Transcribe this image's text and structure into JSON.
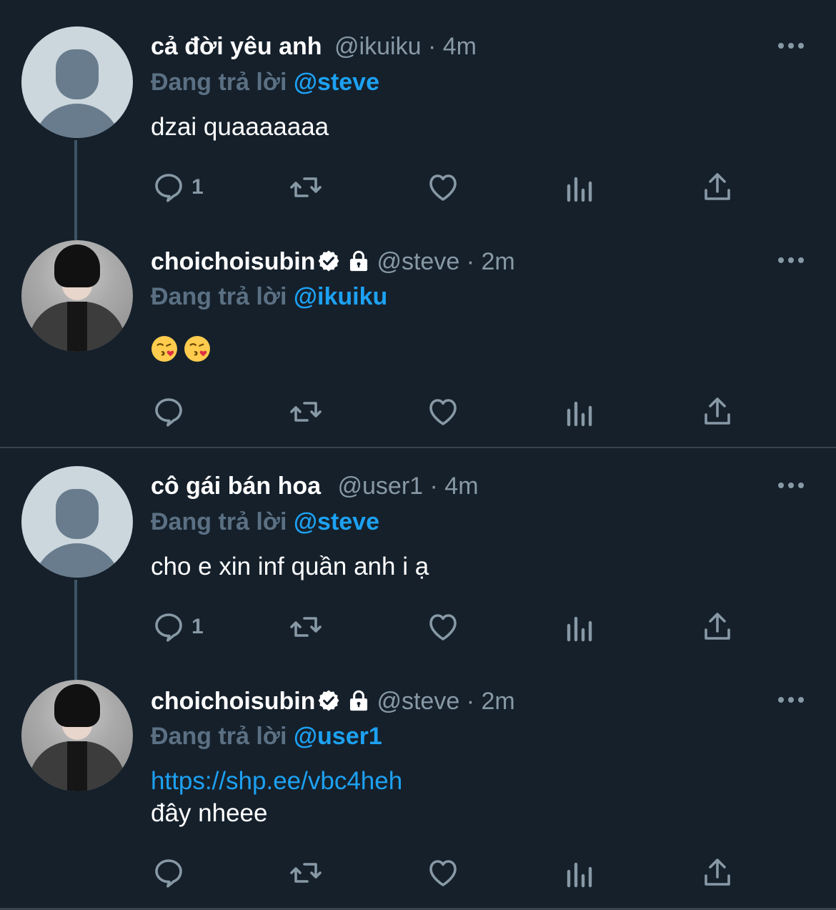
{
  "tweets": [
    {
      "name": "cả đời yêu anh",
      "handle": "@ikuiku",
      "time": "· 4m",
      "reply_prefix": "Đang trả lời",
      "reply_to": "@steve",
      "text": "dzai quaaaaaaa",
      "reply_count": "1",
      "verified": false,
      "protected": false,
      "avatar": "default-avatar"
    },
    {
      "name": "choichoisubin",
      "handle": "@steve",
      "time": "· 2m",
      "reply_prefix": "Đang trả lời",
      "reply_to": "@ikuiku",
      "emojis": [
        "face-blowing-kiss-emoji",
        "face-blowing-kiss-emoji"
      ],
      "reply_count": "",
      "verified": true,
      "protected": true,
      "avatar": "profile-photo"
    },
    {
      "name": "cô gái bán hoa",
      "handle": "@user1",
      "time": "· 4m",
      "reply_prefix": "Đang trả lời",
      "reply_to": "@steve",
      "text": "cho e xin inf quần anh i ạ",
      "reply_count": "1",
      "verified": false,
      "protected": false,
      "avatar": "default-avatar"
    },
    {
      "name": "choichoisubin",
      "handle": "@steve",
      "time": "· 2m",
      "reply_prefix": "Đang trả lời",
      "reply_to": "@user1",
      "link": "https://shp.ee/vbc4heh",
      "text": "đây nheee",
      "reply_count": "",
      "verified": true,
      "protected": true,
      "avatar": "profile-photo"
    }
  ],
  "icons": {
    "reply": "comment-icon",
    "retweet": "retweet-icon",
    "like": "heart-icon",
    "analytics": "analytics-icon",
    "share": "share-icon",
    "more": "more-dots-icon",
    "verified": "verified-badge-icon",
    "protected": "lock-icon"
  },
  "colors": {
    "background": "#15202b",
    "accent": "#1da1f2",
    "muted": "#8899a6",
    "reply_prefix": "#5b7083",
    "divider": "#38444d"
  }
}
